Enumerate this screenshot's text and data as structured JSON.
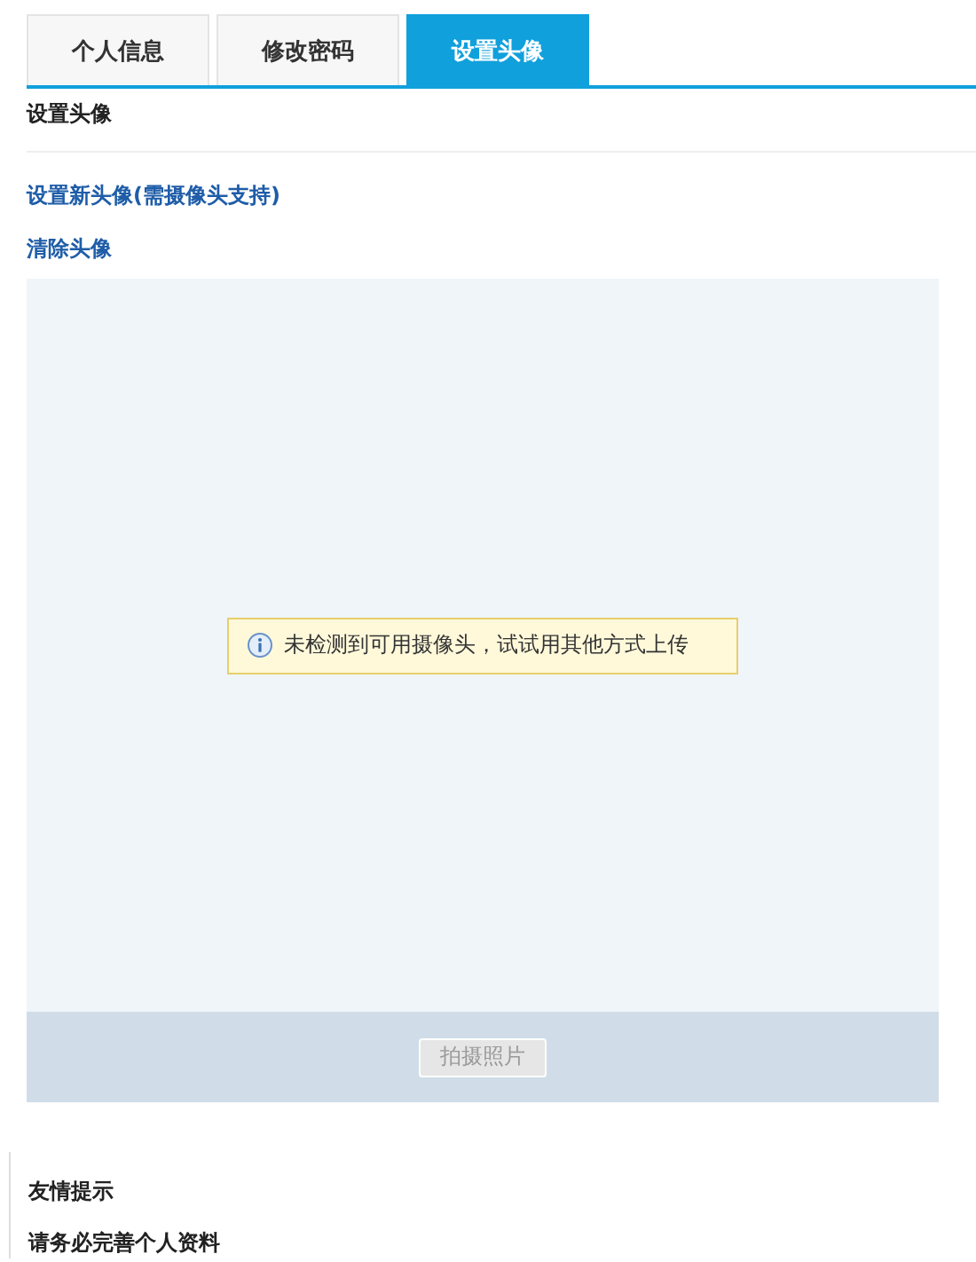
{
  "tabs": [
    {
      "label": "个人信息",
      "selected": false
    },
    {
      "label": "修改密码",
      "selected": false
    },
    {
      "label": "设置头像",
      "selected": true
    }
  ],
  "section_title": "设置头像",
  "links": [
    "设置新头像(需摄像头支持)",
    "清除头像"
  ],
  "camera": {
    "notice": "未检测到可用摄像头，试试用其他方式上传",
    "capture_button": {
      "label": "拍摄照片",
      "disabled": true
    }
  },
  "tips": {
    "title": "友情提示",
    "text": "请务必完善个人资料"
  }
}
